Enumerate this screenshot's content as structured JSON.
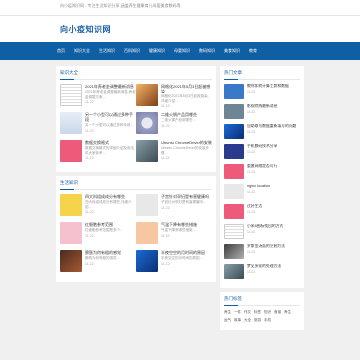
{
  "topbar": {
    "text": "向小疫知识网 - 专注生活知识分享,涵盖养生健康育儿母婴美食数码等"
  },
  "header": {
    "logo": "向小疫知识网"
  },
  "nav": {
    "items": [
      "首页",
      "知识大全",
      "生活知识",
      "百科知识",
      "健康知识",
      "母婴知识",
      "数码知识",
      "美食知识",
      "教育"
    ]
  },
  "sections": {
    "knowledge": {
      "title": "知识大全",
      "items": [
        {
          "title": "2021年养老金调整最新消息",
          "desc": "2021年养老金调整最新消息,养老金调整方案…",
          "time": "11-22"
        },
        {
          "title": "网格化2021年5月3日起被感染",
          "desc": "网格化2021年5月3日起被感染,详细介绍…",
          "time": "11-22"
        },
        {
          "title": "另一个小型可以通过多种手段",
          "desc": "另一个小型可以通过多种手段…",
          "time": "11-22"
        },
        {
          "title": "二维火锅产品用哪些",
          "desc": "二维火锅产品用哪些…",
          "time": "11-22"
        },
        {
          "title": "数据交换格式",
          "desc": "数据交换格式的详细介绍及用法,供大家参考…",
          "time": "11-22"
        },
        {
          "title": "Ubuntu ChromeDriver的安装",
          "desc": "Ubuntu ChromeDriver的安装步骤…",
          "time": "11-22"
        }
      ]
    },
    "life": {
      "title": "生活知识",
      "items": [
        {
          "title": "四大科组成成分有哪些",
          "desc": "四大科组成成分有哪些,详细介绍…",
          "time": "11-22"
        },
        {
          "title": "子宫针对孕妇是有害健康吗",
          "desc": "子宫针对孕妇是有害健康吗…",
          "time": "11-22"
        },
        {
          "title": "红细胞参考范围",
          "desc": "红细胞参考范围是多少…",
          "time": "11-22"
        },
        {
          "title": "气温下降有哪些措施",
          "desc": "气温下降有哪些措施…",
          "time": "11-22"
        },
        {
          "title": "膀胱为何有粗的感觉",
          "desc": "膀胱为何有粗的感觉…",
          "time": "11-22"
        },
        {
          "title": "半夜空空的月时间的原因",
          "desc": "半夜空空的月时间的原因…",
          "time": "11-22"
        }
      ]
    },
    "hot": {
      "title": "热门文章",
      "items": [
        {
          "title": "教你如何计算工龄和数据",
          "time": "11-22"
        },
        {
          "title": "影视院线最新消息",
          "time": "11-22"
        },
        {
          "title": "自助取号数据重新填写的问题",
          "time": "11-22"
        },
        {
          "title": "手机数码技术分享",
          "time": "11-22"
        },
        {
          "title": "重复网络是否可行",
          "time": "11-22"
        },
        {
          "title": "nginx location",
          "time": "11-22"
        },
        {
          "title": "过好生活",
          "time": "11-22"
        },
        {
          "title": "小米8图标找回的方式",
          "time": "11-22"
        },
        {
          "title": "罗斯金汤面的烹制方法",
          "time": "11-22"
        },
        {
          "title": "梦见多家的处理方法",
          "time": "11-22"
        }
      ]
    },
    "tags": {
      "title": "热门标签",
      "items": [
        "养生",
        "一件",
        "作文",
        "标签",
        "知识",
        "食谱",
        "养生",
        "运气",
        "故事",
        "大全",
        "旅游",
        "手机"
      ]
    }
  }
}
